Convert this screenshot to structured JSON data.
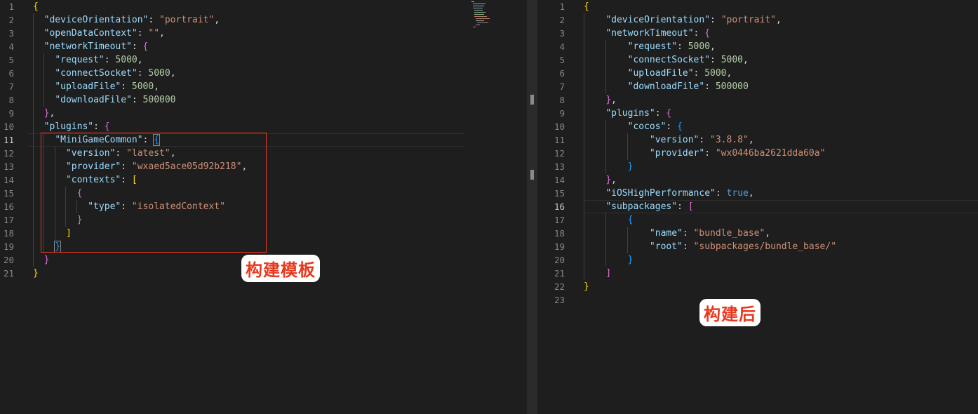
{
  "left_editor": {
    "lines": [
      {
        "no": "1",
        "tokens": [
          {
            "t": "{",
            "c": "b1"
          }
        ]
      },
      {
        "no": "2",
        "tokens": [
          {
            "t": "  "
          },
          {
            "t": "\"deviceOrientation\"",
            "c": "tk-key"
          },
          {
            "t": ": "
          },
          {
            "t": "\"portrait\"",
            "c": "tk-str"
          },
          {
            "t": ","
          }
        ]
      },
      {
        "no": "3",
        "tokens": [
          {
            "t": "  "
          },
          {
            "t": "\"openDataContext\"",
            "c": "tk-key"
          },
          {
            "t": ": "
          },
          {
            "t": "\"\"",
            "c": "tk-str"
          },
          {
            "t": ","
          }
        ]
      },
      {
        "no": "4",
        "tokens": [
          {
            "t": "  "
          },
          {
            "t": "\"networkTimeout\"",
            "c": "tk-key"
          },
          {
            "t": ": "
          },
          {
            "t": "{",
            "c": "b2"
          }
        ]
      },
      {
        "no": "5",
        "tokens": [
          {
            "t": "    "
          },
          {
            "t": "\"request\"",
            "c": "tk-key"
          },
          {
            "t": ": "
          },
          {
            "t": "5000",
            "c": "tk-num"
          },
          {
            "t": ","
          }
        ]
      },
      {
        "no": "6",
        "tokens": [
          {
            "t": "    "
          },
          {
            "t": "\"connectSocket\"",
            "c": "tk-key"
          },
          {
            "t": ": "
          },
          {
            "t": "5000",
            "c": "tk-num"
          },
          {
            "t": ","
          }
        ]
      },
      {
        "no": "7",
        "tokens": [
          {
            "t": "    "
          },
          {
            "t": "\"uploadFile\"",
            "c": "tk-key"
          },
          {
            "t": ": "
          },
          {
            "t": "5000",
            "c": "tk-num"
          },
          {
            "t": ","
          }
        ]
      },
      {
        "no": "8",
        "tokens": [
          {
            "t": "    "
          },
          {
            "t": "\"downloadFile\"",
            "c": "tk-key"
          },
          {
            "t": ": "
          },
          {
            "t": "500000",
            "c": "tk-num"
          }
        ]
      },
      {
        "no": "9",
        "tokens": [
          {
            "t": "  "
          },
          {
            "t": "}",
            "c": "b2"
          },
          {
            "t": ","
          }
        ]
      },
      {
        "no": "10",
        "tokens": [
          {
            "t": "  "
          },
          {
            "t": "\"plugins\"",
            "c": "tk-key"
          },
          {
            "t": ": "
          },
          {
            "t": "{",
            "c": "b2"
          }
        ]
      },
      {
        "no": "11",
        "current": true,
        "tokens": [
          {
            "t": "    "
          },
          {
            "t": "\"MiniGameCommon\"",
            "c": "tk-key"
          },
          {
            "t": ": "
          },
          {
            "t": "{",
            "c": "b3 bm"
          }
        ]
      },
      {
        "no": "12",
        "tokens": [
          {
            "t": "      "
          },
          {
            "t": "\"version\"",
            "c": "tk-key"
          },
          {
            "t": ": "
          },
          {
            "t": "\"latest\"",
            "c": "tk-str"
          },
          {
            "t": ","
          }
        ]
      },
      {
        "no": "13",
        "tokens": [
          {
            "t": "      "
          },
          {
            "t": "\"provider\"",
            "c": "tk-key"
          },
          {
            "t": ": "
          },
          {
            "t": "\"wxaed5ace05d92b218\"",
            "c": "tk-str"
          },
          {
            "t": ","
          }
        ]
      },
      {
        "no": "14",
        "tokens": [
          {
            "t": "      "
          },
          {
            "t": "\"contexts\"",
            "c": "tk-key"
          },
          {
            "t": ": "
          },
          {
            "t": "[",
            "c": "b1"
          }
        ]
      },
      {
        "no": "15",
        "tokens": [
          {
            "t": "        "
          },
          {
            "t": "{",
            "c": "b2"
          }
        ]
      },
      {
        "no": "16",
        "tokens": [
          {
            "t": "          "
          },
          {
            "t": "\"type\"",
            "c": "tk-key"
          },
          {
            "t": ": "
          },
          {
            "t": "\"isolatedContext\"",
            "c": "tk-str"
          }
        ]
      },
      {
        "no": "17",
        "tokens": [
          {
            "t": "        "
          },
          {
            "t": "}",
            "c": "b2"
          }
        ]
      },
      {
        "no": "18",
        "tokens": [
          {
            "t": "      "
          },
          {
            "t": "]",
            "c": "b1"
          }
        ]
      },
      {
        "no": "19",
        "tokens": [
          {
            "t": "    "
          },
          {
            "t": "}",
            "c": "b3 bm"
          }
        ]
      },
      {
        "no": "20",
        "tokens": [
          {
            "t": "  "
          },
          {
            "t": "}",
            "c": "b2"
          }
        ]
      },
      {
        "no": "21",
        "tokens": [
          {
            "t": "}",
            "c": "b1"
          }
        ]
      }
    ]
  },
  "right_editor": {
    "lines": [
      {
        "no": "1",
        "tokens": [
          {
            "t": "{",
            "c": "b1"
          }
        ]
      },
      {
        "no": "2",
        "tokens": [
          {
            "t": "    "
          },
          {
            "t": "\"deviceOrientation\"",
            "c": "tk-key"
          },
          {
            "t": ": "
          },
          {
            "t": "\"portrait\"",
            "c": "tk-str"
          },
          {
            "t": ","
          }
        ]
      },
      {
        "no": "3",
        "tokens": [
          {
            "t": "    "
          },
          {
            "t": "\"networkTimeout\"",
            "c": "tk-key"
          },
          {
            "t": ": "
          },
          {
            "t": "{",
            "c": "b2"
          }
        ]
      },
      {
        "no": "4",
        "tokens": [
          {
            "t": "        "
          },
          {
            "t": "\"request\"",
            "c": "tk-key"
          },
          {
            "t": ": "
          },
          {
            "t": "5000",
            "c": "tk-num"
          },
          {
            "t": ","
          }
        ]
      },
      {
        "no": "5",
        "tokens": [
          {
            "t": "        "
          },
          {
            "t": "\"connectSocket\"",
            "c": "tk-key"
          },
          {
            "t": ": "
          },
          {
            "t": "5000",
            "c": "tk-num"
          },
          {
            "t": ","
          }
        ]
      },
      {
        "no": "6",
        "tokens": [
          {
            "t": "        "
          },
          {
            "t": "\"uploadFile\"",
            "c": "tk-key"
          },
          {
            "t": ": "
          },
          {
            "t": "5000",
            "c": "tk-num"
          },
          {
            "t": ","
          }
        ]
      },
      {
        "no": "7",
        "tokens": [
          {
            "t": "        "
          },
          {
            "t": "\"downloadFile\"",
            "c": "tk-key"
          },
          {
            "t": ": "
          },
          {
            "t": "500000",
            "c": "tk-num"
          }
        ]
      },
      {
        "no": "8",
        "tokens": [
          {
            "t": "    "
          },
          {
            "t": "}",
            "c": "b2"
          },
          {
            "t": ","
          }
        ]
      },
      {
        "no": "9",
        "tokens": [
          {
            "t": "    "
          },
          {
            "t": "\"plugins\"",
            "c": "tk-key"
          },
          {
            "t": ": "
          },
          {
            "t": "{",
            "c": "b2"
          }
        ]
      },
      {
        "no": "10",
        "tokens": [
          {
            "t": "        "
          },
          {
            "t": "\"cocos\"",
            "c": "tk-key"
          },
          {
            "t": ": "
          },
          {
            "t": "{",
            "c": "b3"
          }
        ]
      },
      {
        "no": "11",
        "tokens": [
          {
            "t": "            "
          },
          {
            "t": "\"version\"",
            "c": "tk-key"
          },
          {
            "t": ": "
          },
          {
            "t": "\"3.8.8\"",
            "c": "tk-str"
          },
          {
            "t": ","
          }
        ]
      },
      {
        "no": "12",
        "tokens": [
          {
            "t": "            "
          },
          {
            "t": "\"provider\"",
            "c": "tk-key"
          },
          {
            "t": ": "
          },
          {
            "t": "\"wx0446ba2621dda60a\"",
            "c": "tk-str"
          }
        ]
      },
      {
        "no": "13",
        "tokens": [
          {
            "t": "        "
          },
          {
            "t": "}",
            "c": "b3"
          }
        ]
      },
      {
        "no": "14",
        "tokens": [
          {
            "t": "    "
          },
          {
            "t": "}",
            "c": "b2"
          },
          {
            "t": ","
          }
        ]
      },
      {
        "no": "15",
        "tokens": [
          {
            "t": "    "
          },
          {
            "t": "\"iOSHighPerformance\"",
            "c": "tk-key"
          },
          {
            "t": ": "
          },
          {
            "t": "true",
            "c": "tk-bool"
          },
          {
            "t": ","
          }
        ]
      },
      {
        "no": "16",
        "current": true,
        "tokens": [
          {
            "t": "    "
          },
          {
            "t": "\"subpackages\"",
            "c": "tk-key"
          },
          {
            "t": ": "
          },
          {
            "t": "[",
            "c": "b2"
          }
        ]
      },
      {
        "no": "17",
        "tokens": [
          {
            "t": "        "
          },
          {
            "t": "{",
            "c": "b3"
          }
        ]
      },
      {
        "no": "18",
        "tokens": [
          {
            "t": "            "
          },
          {
            "t": "\"name\"",
            "c": "tk-key"
          },
          {
            "t": ": "
          },
          {
            "t": "\"bundle_base\"",
            "c": "tk-str"
          },
          {
            "t": ","
          }
        ]
      },
      {
        "no": "19",
        "tokens": [
          {
            "t": "            "
          },
          {
            "t": "\"root\"",
            "c": "tk-key"
          },
          {
            "t": ": "
          },
          {
            "t": "\"subpackages/bundle_base/\"",
            "c": "tk-str"
          }
        ]
      },
      {
        "no": "20",
        "tokens": [
          {
            "t": "        "
          },
          {
            "t": "}",
            "c": "b3"
          }
        ]
      },
      {
        "no": "21",
        "tokens": [
          {
            "t": "    "
          },
          {
            "t": "]",
            "c": "b2"
          }
        ]
      },
      {
        "no": "22",
        "tokens": [
          {
            "t": "}",
            "c": "b1"
          }
        ]
      },
      {
        "no": "23",
        "tokens": []
      }
    ]
  },
  "annotations": {
    "template_label": "构建模板",
    "after_label": "构建后"
  },
  "colors": {
    "background": "#1e1e1e",
    "highlight_box": "#e8391f",
    "key": "#9cdcfe",
    "string": "#ce9178",
    "number": "#b5cea8",
    "boolean": "#569cd6"
  }
}
